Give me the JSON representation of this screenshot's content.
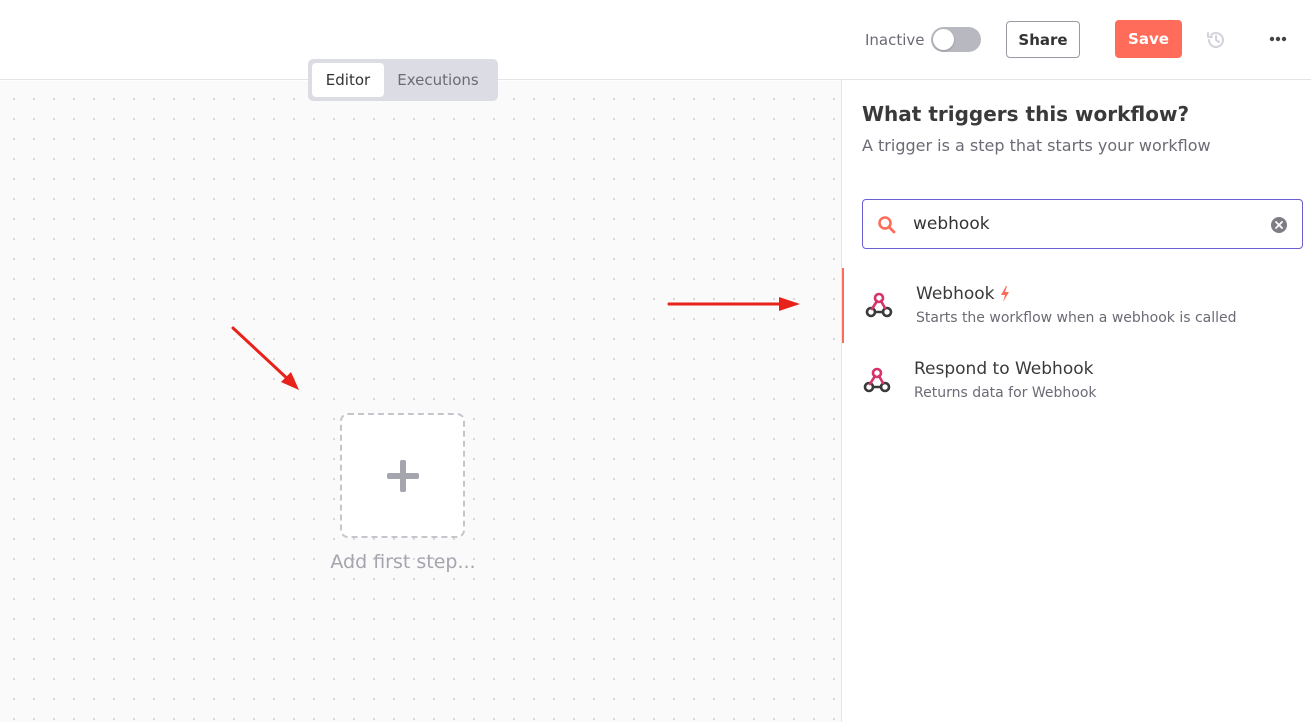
{
  "header": {
    "status_label": "Inactive",
    "share_label": "Share",
    "save_label": "Save",
    "accent_color": "#ff6d5a"
  },
  "tabs": [
    {
      "label": "Editor",
      "active": true
    },
    {
      "label": "Executions",
      "active": false
    }
  ],
  "canvas": {
    "add_label": "Add first step..."
  },
  "panel": {
    "title": "What triggers this workflow?",
    "subtitle": "A trigger is a step that starts your workflow",
    "search": {
      "value": "webhook",
      "icon": "search-icon"
    },
    "results": [
      {
        "name": "Webhook",
        "description": "Starts the workflow when a webhook is called",
        "icon": "webhook-icon",
        "badge_icon": "bolt-icon",
        "selected": true
      },
      {
        "name": "Respond to Webhook",
        "description": "Returns data for Webhook",
        "icon": "webhook-icon",
        "selected": false
      }
    ]
  }
}
